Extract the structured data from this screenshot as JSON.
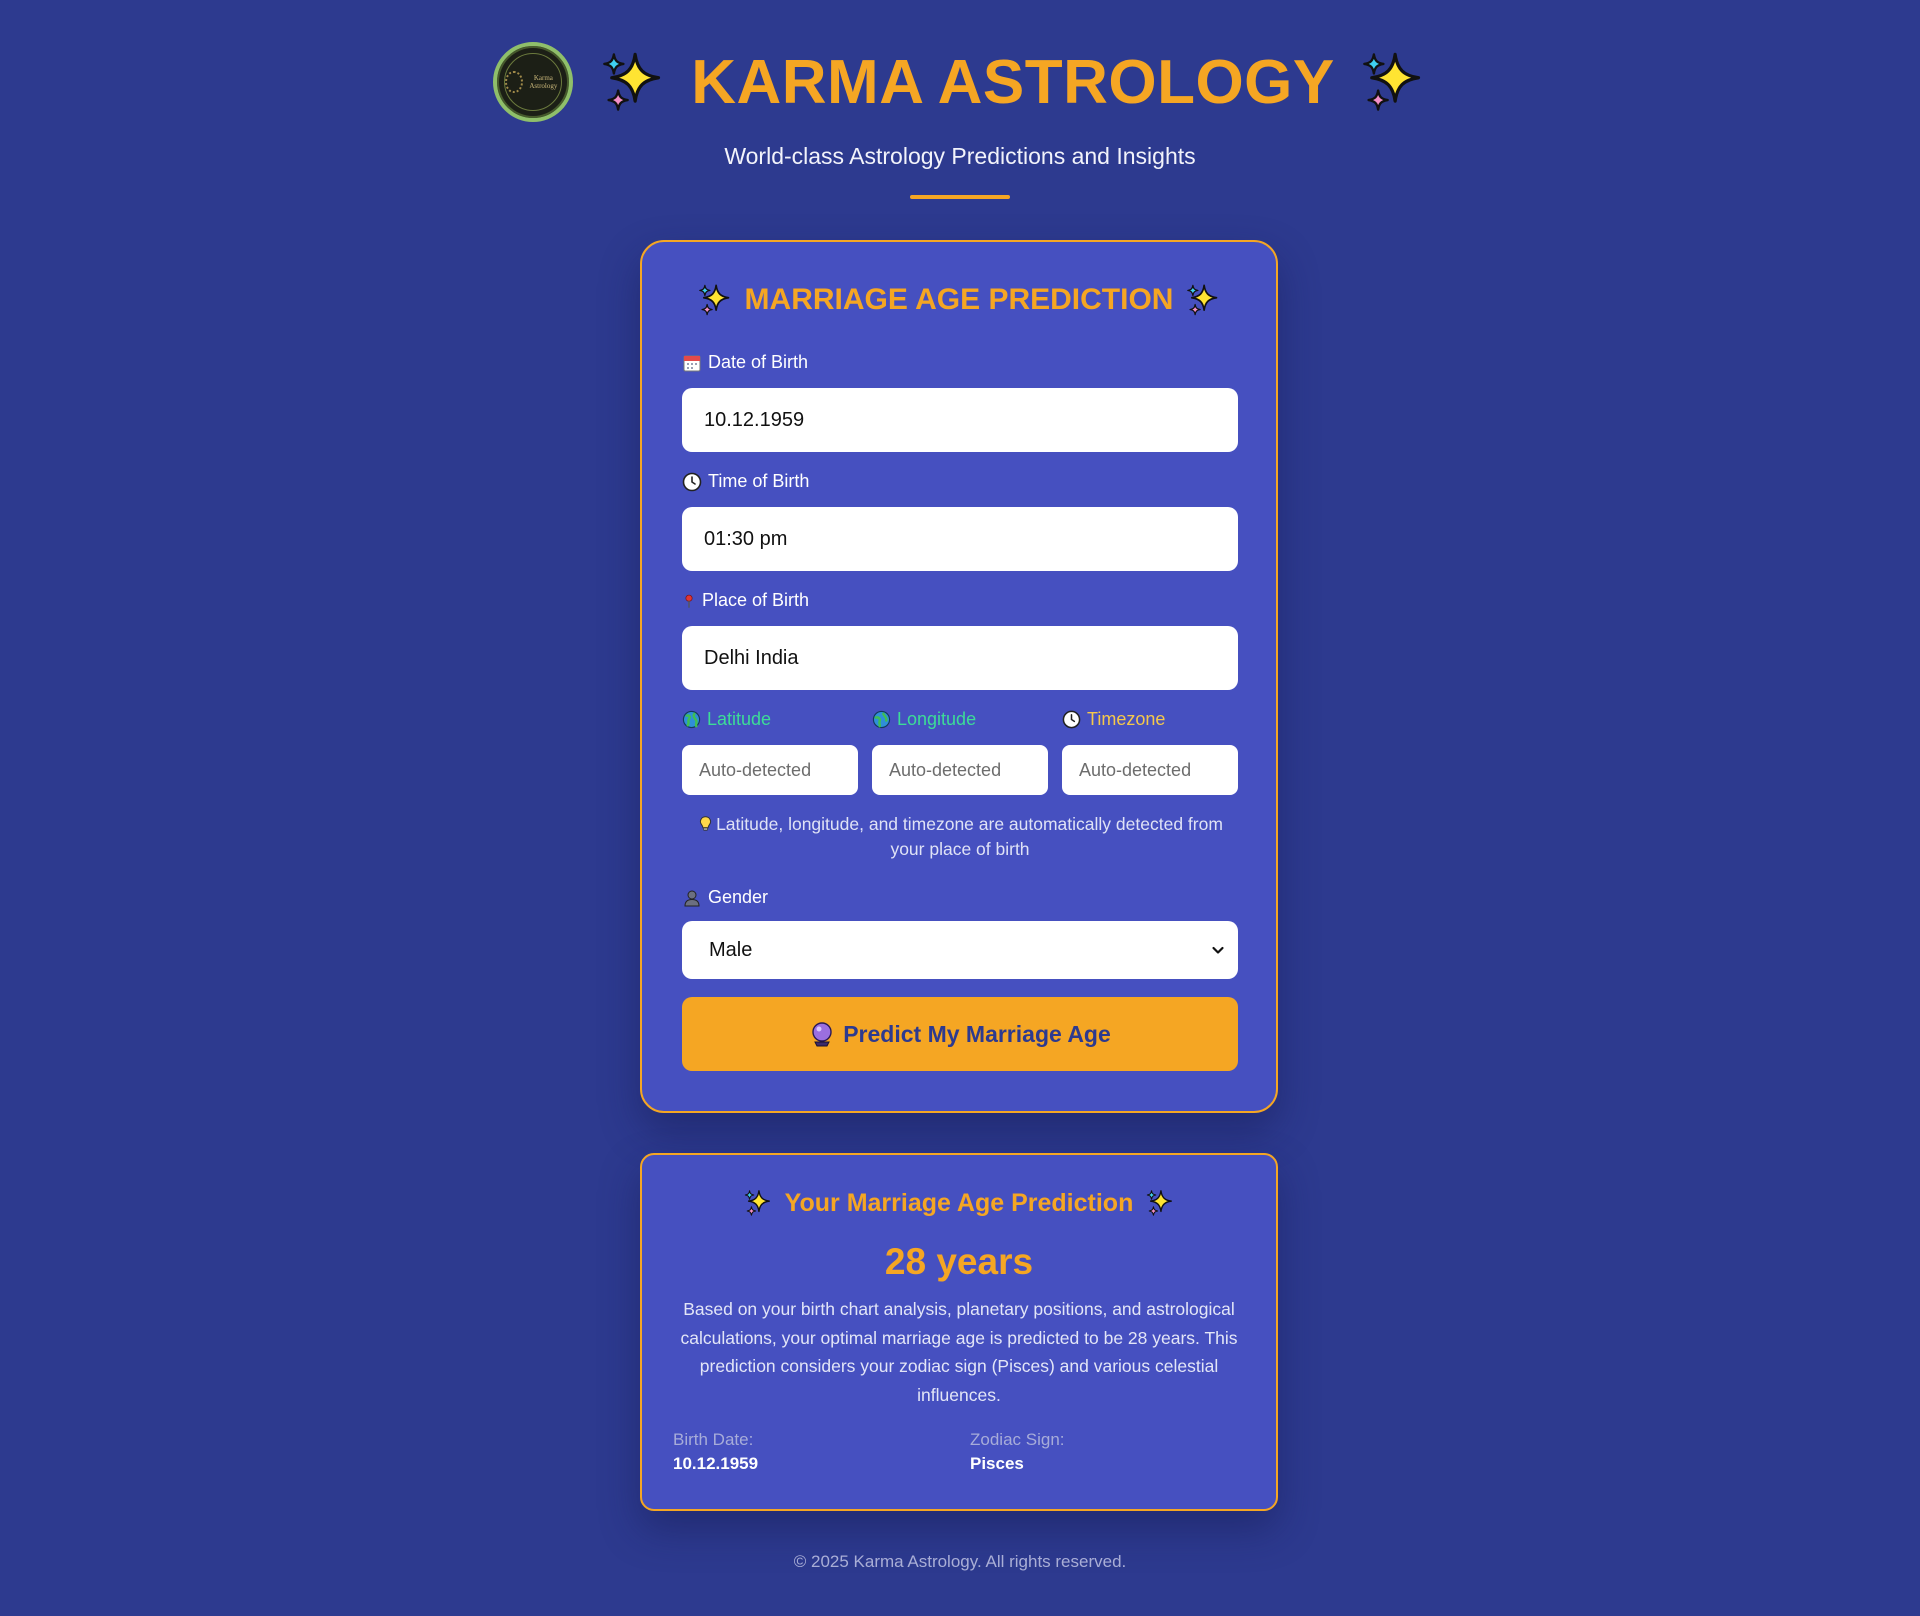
{
  "header": {
    "logo_text": "Karma Astrology",
    "brand": "KARMA ASTROLOGY",
    "tagline": "World-class Astrology Predictions and Insights"
  },
  "form": {
    "title": "MARRIAGE AGE PREDICTION",
    "dob_label": "Date of Birth",
    "dob_value": "10.12.1959",
    "tob_label": "Time of Birth",
    "tob_value": "01:30 pm",
    "pob_label": "Place of Birth",
    "pob_value": "Delhi India",
    "latitude_label": "Latitude",
    "latitude_placeholder": "Auto-detected",
    "longitude_label": "Longitude",
    "longitude_placeholder": "Auto-detected",
    "timezone_label": "Timezone",
    "timezone_placeholder": "Auto-detected",
    "hint": "Latitude, longitude, and timezone are automatically detected from your place of birth",
    "gender_label": "Gender",
    "gender_value": "Male",
    "submit_label": "Predict My Marriage Age"
  },
  "result": {
    "title": "Your Marriage Age Prediction",
    "age": "28 years",
    "explanation": "Based on your birth chart analysis, planetary positions, and astrological calculations, your optimal marriage age is predicted to be 28 years. This prediction considers your zodiac sign (Pisces) and various celestial influences.",
    "birth_date_label": "Birth Date:",
    "birth_date_value": "10.12.1959",
    "zodiac_label": "Zodiac Sign:",
    "zodiac_value": "Pisces"
  },
  "footer": {
    "copyright": "© 2025 Karma Astrology. All rights reserved."
  },
  "colors": {
    "background": "#2d3a8f",
    "card": "#4650c0",
    "accent": "#f5a623",
    "latitude_label": "#3ddc97",
    "longitude_label": "#3ddc97",
    "timezone_label": "#f5c84a"
  },
  "icons": {
    "header": [
      "logo",
      "sparkles-icon"
    ],
    "dob": "calendar-icon",
    "tob": "clock-icon",
    "pob": "pushpin-icon",
    "latitude": "globe-icon",
    "longitude": "globe-icon",
    "timezone": "clock-icon",
    "hint": "lightbulb-icon",
    "gender": "person-icon",
    "submit": "crystal-ball-icon"
  }
}
